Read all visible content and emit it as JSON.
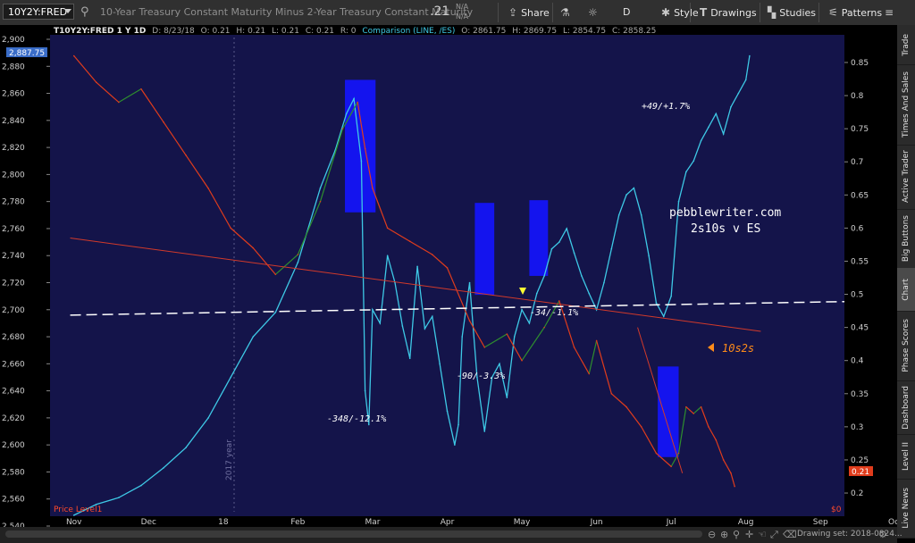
{
  "toolbar": {
    "symbol": "10Y2Y:FRED",
    "description": "10-Year Treasury Constant Maturity Minus 2-Year Treasury Constant Maturity",
    "last_price": ".21",
    "na_top": "N/A",
    "na_bottom": "N/A",
    "share_label": "Share",
    "interval_label": "D",
    "style_label": "Style",
    "drawings_label": "Drawings",
    "studies_label": "Studies",
    "patterns_label": "Patterns"
  },
  "header_info": {
    "main": "T10Y2Y:FRED 1 Y 1D",
    "date": "D: 8/23/18",
    "open": "O: 0.21",
    "high": "H: 0.21",
    "low": "L: 0.21",
    "close": "C: 0.21",
    "r": "R: 0",
    "comparison": "Comparison (LINE, /ES)",
    "comp_open": "O: 2861.75",
    "comp_high": "H: 2869.75",
    "comp_low": "L: 2854.75",
    "comp_close": "C: 2858.25"
  },
  "annotations": {
    "watermark_line1": "pebblewriter.com",
    "watermark_line2": "2s10s v ES",
    "a1": "+49/+1.7%",
    "a2": "-348/-12.1%",
    "a3": "-90/-3.3%",
    "a4": "-34/-1.1%",
    "a5": "10s2s",
    "year_marker": "2017 year",
    "price_level": "Price Level1",
    "current_es": "2,887.75",
    "current_spread": "0.21",
    "right_zero": "$0"
  },
  "sidebar_tabs": [
    "Trade",
    "Times And Sales",
    "Active Trader",
    "Big Buttons",
    "Chart",
    "Phase Scores",
    "Dashboard",
    "Level II",
    "Live News"
  ],
  "bottom": {
    "drawing_set": "Drawing set: 2018-0824..."
  },
  "colors": {
    "background": "#14144a",
    "es_line": "#3ec9e6",
    "spread_down": "#e03c1c",
    "spread_up": "#2e8f2e",
    "highlight_box": "#1414ee",
    "trendline_red": "#d23a2a",
    "dashed_line": "#ffffff",
    "arrow_yellow": "#ffff33",
    "orange": "#ff8c1a"
  },
  "chart_data": {
    "type": "line",
    "x_ticks": [
      "Nov",
      "Dec",
      "18",
      "Feb",
      "Mar",
      "Apr",
      "May",
      "Jun",
      "Jul",
      "Aug",
      "Sep",
      "Oct"
    ],
    "left_axis": {
      "ticks": [
        "2,900",
        "2,880",
        "2,860",
        "2,840",
        "2,820",
        "2,800",
        "2,780",
        "2,760",
        "2,740",
        "2,720",
        "2,700",
        "2,680",
        "2,660",
        "2,640",
        "2,620",
        "2,600",
        "2,580",
        "2,560",
        "2,540"
      ],
      "range": [
        2540,
        2900
      ]
    },
    "right_axis": {
      "ticks": [
        "0.85",
        "0.8",
        "0.75",
        "0.7",
        "0.65",
        "0.6",
        "0.55",
        "0.5",
        "0.45",
        "0.4",
        "0.35",
        "0.3",
        "0.25",
        "0.2"
      ],
      "range": [
        0.165,
        0.885
      ]
    },
    "series": [
      {
        "name": "Comparison (LINE, /ES)",
        "axis": "left",
        "points": [
          [
            0.0,
            2548
          ],
          [
            0.3,
            2556
          ],
          [
            0.6,
            2561
          ],
          [
            0.9,
            2570
          ],
          [
            1.2,
            2583
          ],
          [
            1.5,
            2598
          ],
          [
            1.8,
            2620
          ],
          [
            2.1,
            2650
          ],
          [
            2.4,
            2680
          ],
          [
            2.7,
            2698
          ],
          [
            3.0,
            2735
          ],
          [
            3.3,
            2790
          ],
          [
            3.5,
            2818
          ],
          [
            3.65,
            2845
          ],
          [
            3.75,
            2856
          ],
          [
            3.85,
            2810
          ],
          [
            3.9,
            2640
          ],
          [
            3.95,
            2615
          ],
          [
            4.0,
            2700
          ],
          [
            4.1,
            2690
          ],
          [
            4.2,
            2740
          ],
          [
            4.3,
            2720
          ],
          [
            4.4,
            2688
          ],
          [
            4.5,
            2664
          ],
          [
            4.6,
            2732
          ],
          [
            4.7,
            2686
          ],
          [
            4.8,
            2695
          ],
          [
            4.9,
            2660
          ],
          [
            5.0,
            2625
          ],
          [
            5.1,
            2600
          ],
          [
            5.15,
            2615
          ],
          [
            5.2,
            2680
          ],
          [
            5.3,
            2720
          ],
          [
            5.4,
            2650
          ],
          [
            5.5,
            2610
          ],
          [
            5.6,
            2650
          ],
          [
            5.7,
            2660
          ],
          [
            5.8,
            2635
          ],
          [
            5.9,
            2680
          ],
          [
            6.0,
            2700
          ],
          [
            6.1,
            2690
          ],
          [
            6.2,
            2712
          ],
          [
            6.3,
            2725
          ],
          [
            6.4,
            2745
          ],
          [
            6.5,
            2750
          ],
          [
            6.6,
            2760
          ],
          [
            6.7,
            2742
          ],
          [
            6.8,
            2725
          ],
          [
            6.9,
            2712
          ],
          [
            7.0,
            2700
          ],
          [
            7.1,
            2720
          ],
          [
            7.2,
            2745
          ],
          [
            7.3,
            2770
          ],
          [
            7.4,
            2785
          ],
          [
            7.5,
            2790
          ],
          [
            7.6,
            2770
          ],
          [
            7.7,
            2740
          ],
          [
            7.8,
            2705
          ],
          [
            7.9,
            2695
          ],
          [
            8.0,
            2710
          ],
          [
            8.1,
            2780
          ],
          [
            8.2,
            2802
          ],
          [
            8.3,
            2810
          ],
          [
            8.4,
            2825
          ],
          [
            8.5,
            2835
          ],
          [
            8.6,
            2845
          ],
          [
            8.7,
            2830
          ],
          [
            8.8,
            2850
          ],
          [
            8.9,
            2860
          ],
          [
            9.0,
            2870
          ],
          [
            9.05,
            2887.75
          ]
        ]
      },
      {
        "name": "T10Y2Y:FRED 1 Y 1D",
        "axis": "right",
        "points": [
          [
            0.0,
            0.86
          ],
          [
            0.3,
            0.82
          ],
          [
            0.6,
            0.79
          ],
          [
            0.9,
            0.81
          ],
          [
            1.2,
            0.76
          ],
          [
            1.5,
            0.71
          ],
          [
            1.8,
            0.66
          ],
          [
            2.1,
            0.6
          ],
          [
            2.4,
            0.57
          ],
          [
            2.7,
            0.53
          ],
          [
            3.0,
            0.56
          ],
          [
            3.3,
            0.64
          ],
          [
            3.6,
            0.75
          ],
          [
            3.8,
            0.79
          ],
          [
            3.9,
            0.72
          ],
          [
            4.0,
            0.66
          ],
          [
            4.2,
            0.6
          ],
          [
            4.5,
            0.58
          ],
          [
            4.8,
            0.56
          ],
          [
            5.0,
            0.54
          ],
          [
            5.3,
            0.46
          ],
          [
            5.5,
            0.42
          ],
          [
            5.8,
            0.44
          ],
          [
            6.0,
            0.4
          ],
          [
            6.3,
            0.45
          ],
          [
            6.5,
            0.49
          ],
          [
            6.7,
            0.42
          ],
          [
            6.9,
            0.38
          ],
          [
            7.0,
            0.43
          ],
          [
            7.2,
            0.35
          ],
          [
            7.4,
            0.33
          ],
          [
            7.6,
            0.3
          ],
          [
            7.8,
            0.26
          ],
          [
            8.0,
            0.24
          ],
          [
            8.1,
            0.26
          ],
          [
            8.2,
            0.33
          ],
          [
            8.3,
            0.32
          ],
          [
            8.4,
            0.33
          ],
          [
            8.5,
            0.3
          ],
          [
            8.6,
            0.28
          ],
          [
            8.7,
            0.25
          ],
          [
            8.8,
            0.23
          ],
          [
            8.85,
            0.21
          ]
        ]
      }
    ],
    "highlight_boxes": [
      {
        "x": [
          3.63,
          4.04
        ],
        "y": [
          2772,
          2870
        ]
      },
      {
        "x": [
          5.37,
          5.63
        ],
        "y": [
          2711,
          2779
        ]
      },
      {
        "x": [
          6.1,
          6.35
        ],
        "y": [
          2725,
          2781
        ]
      },
      {
        "x": [
          7.82,
          8.1
        ],
        "y": [
          2591,
          2658
        ]
      }
    ],
    "red_trendline": {
      "from": [
        -0.05,
        2753
      ],
      "to": [
        9.2,
        2684
      ]
    },
    "dashed_line": {
      "from": [
        -0.05,
        2696
      ],
      "to": [
        10.32,
        2706
      ]
    },
    "legend": "none",
    "grid": false
  }
}
